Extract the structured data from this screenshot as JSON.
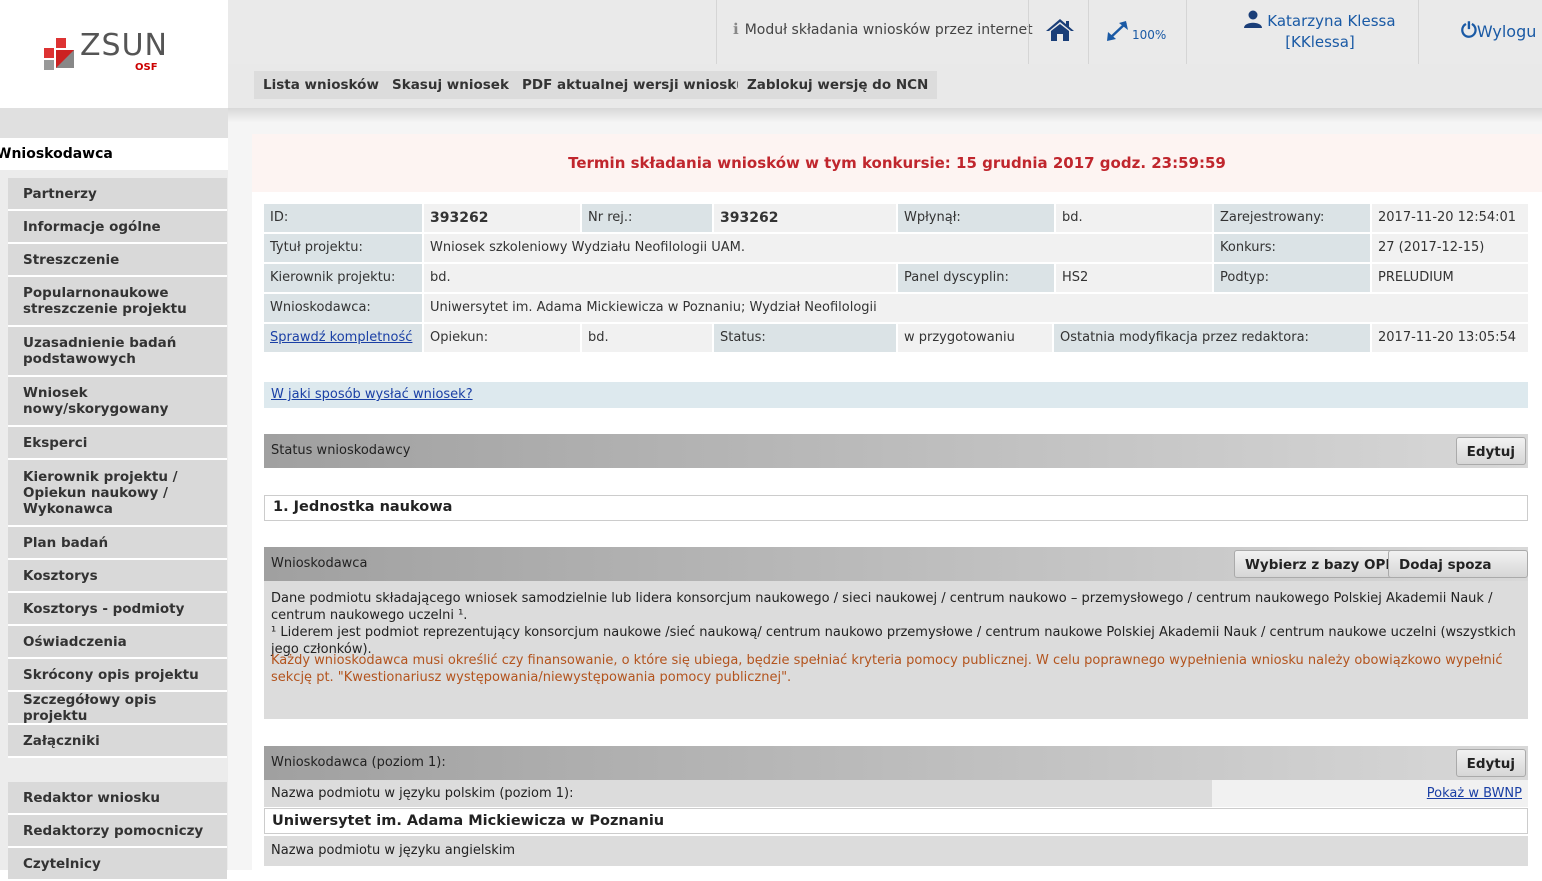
{
  "logo": {
    "name": "ZSUN",
    "sub": "OSF"
  },
  "header": {
    "module": "Moduł składania wniosków przez internet",
    "zoom": "100%",
    "user_name": "Katarzyna Klessa",
    "user_login": "[KKlessa]",
    "logout": "Wylogu"
  },
  "toolbar": [
    {
      "label": "Lista wniosków"
    },
    {
      "label": "Skasuj wniosek"
    },
    {
      "label": "PDF aktualnej wersji wniosku"
    },
    {
      "label": "Zablokuj wersję do NCN"
    }
  ],
  "sidebar": {
    "active": "Wnioskodawca",
    "items": [
      "Partnerzy",
      "Informacje ogólne",
      "Streszczenie",
      "Popularnonaukowe streszczenie projektu",
      "Uzasadnienie badań podstawowych",
      "Wniosek nowy/skorygowany",
      "Eksperci",
      "Kierownik projektu / Opiekun naukowy / Wykonawca",
      "Plan badań",
      "Kosztorys",
      "Kosztorys - podmioty",
      "Oświadczenia",
      "Skrócony opis projektu",
      "Szczegółowy opis projektu",
      "Załączniki"
    ],
    "bottom_items": [
      "Redaktor wniosku",
      "Redaktorzy pomocniczy",
      "Czytelnicy"
    ]
  },
  "deadline": "Termin składania wniosków w tym konkursie: 15 grudnia 2017 godz. 23:59:59",
  "info": {
    "id_label": "ID:",
    "id": "393262",
    "nr_label": "Nr rej.:",
    "nr": "393262",
    "wplynal_label": "Wpłynął:",
    "wplynal": "bd.",
    "zarej_label": "Zarejestrowany:",
    "zarej": "2017-11-20 12:54:01",
    "tytul_label": "Tytuł projektu:",
    "tytul": "Wniosek szkoleniowy Wydziału Neofilologii UAM.",
    "konkurs_label": "Konkurs:",
    "konkurs": "27 (2017-12-15)",
    "kier_label": "Kierownik projektu:",
    "kier": "bd.",
    "panel_label": "Panel dyscyplin:",
    "panel": "HS2",
    "podtyp_label": "Podtyp:",
    "podtyp": "PRELUDIUM",
    "wnios_label": "Wnioskodawca:",
    "wnios": "Uniwersytet im. Adama Mickiewicza w Poznaniu; Wydział Neofilologii",
    "sprawdz": "Sprawdź kompletność",
    "opiekun_label": "Opiekun:",
    "opiekun": "bd.",
    "status_label": "Status:",
    "status": "w przygotowaniu",
    "ostatnia_label": "Ostatnia modyfikacja przez redaktora:",
    "ostatnia": "2017-11-20 13:05:54"
  },
  "how_send": "W jaki sposób wysłać wniosek?",
  "status_section": {
    "title": "Status wnioskodawcy",
    "edit": "Edytuj"
  },
  "jednostka": "1. Jednostka naukowa",
  "wnioskodawca_section": {
    "title": "Wnioskodawca",
    "btn_opi": "Wybierz z bazy OPI",
    "btn_add": "Dodaj spoza bazy",
    "p1": "Dane podmiotu składającego wniosek samodzielnie lub lidera konsorcjum naukowego / sieci naukowej / centrum naukowo – przemysłowego / centrum naukowego Polskiej Akademii Nauk / centrum naukowego uczelni ¹.",
    "p2": "¹ Liderem jest podmiot reprezentujący konsorcjum naukowe /sieć naukową/ centrum naukowo przemysłowe / centrum naukowe Polskiej Akademii Nauk / centrum naukowe uczelni (wszystkich jego członków).",
    "warn": "Każdy wnioskodawca musi określić czy finansowanie, o które się ubiega, będzie spełniać kryteria pomocy publicznej. W celu poprawnego wypełnienia wniosku należy obowiązkowo wypełnić sekcję pt. \"Kwestionariusz występowania/niewystępowania pomocy publicznej\"."
  },
  "level1": {
    "title": "Wnioskodawca (poziom 1):",
    "edit": "Edytuj",
    "name_pl_label": "Nazwa podmiotu w języku polskim (poziom 1):",
    "bwnp_link": "Pokaż w BWNP",
    "name_pl": "Uniwersytet im. Adama Mickiewicza w Poznaniu",
    "name_en_label": "Nazwa podmiotu w języku angielskim"
  }
}
